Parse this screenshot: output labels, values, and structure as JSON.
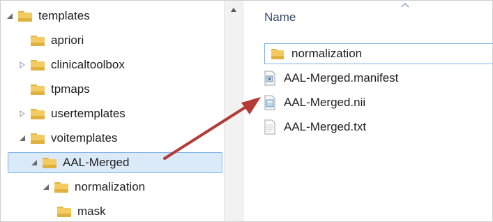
{
  "tree": {
    "items": [
      {
        "label": "templates",
        "expanded": true
      },
      {
        "label": "apriori"
      },
      {
        "label": "clinicaltoolbox",
        "collapsed": true
      },
      {
        "label": "tpmaps"
      },
      {
        "label": "usertemplates",
        "collapsed": true
      },
      {
        "label": "voitemplates",
        "expanded": true
      },
      {
        "label": "AAL-Merged",
        "expanded": true,
        "selected": true
      },
      {
        "label": "normalization",
        "expanded": true
      },
      {
        "label": "mask"
      }
    ]
  },
  "content": {
    "column_header": "Name",
    "files": [
      {
        "name": "normalization",
        "icon": "folder-icon",
        "focused": true
      },
      {
        "name": "AAL-Merged.manifest",
        "icon": "manifest-file-icon"
      },
      {
        "name": "AAL-Merged.nii",
        "icon": "nii-file-icon"
      },
      {
        "name": "AAL-Merged.txt",
        "icon": "text-file-icon"
      }
    ]
  },
  "colors": {
    "selection_bg": "#dbeaf9",
    "selection_border": "#7fb3e6",
    "arrow": "#b33a36",
    "header_text": "#3b4a6b"
  }
}
